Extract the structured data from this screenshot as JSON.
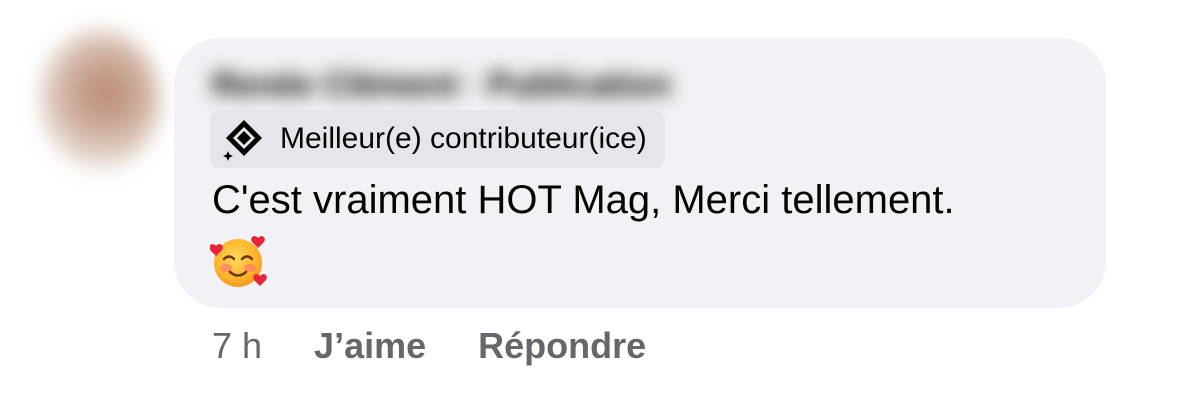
{
  "comment": {
    "author_name": "Renée Clément · Publication",
    "badge": {
      "icon": "top-contributor-diamond-icon",
      "label": "Meilleur(e) contributeur(ice)"
    },
    "text": "C'est vraiment HOT Mag, Merci tellement.",
    "emoji": "smiling-face-with-hearts-emoji",
    "colors": {
      "bubble_bg": "#f0f2f5",
      "badge_bg": "#e4e6eb",
      "text": "#050505",
      "meta": "#65676b"
    }
  },
  "actions": {
    "time": "7 h",
    "like_label": "J’aime",
    "reply_label": "Répondre"
  }
}
